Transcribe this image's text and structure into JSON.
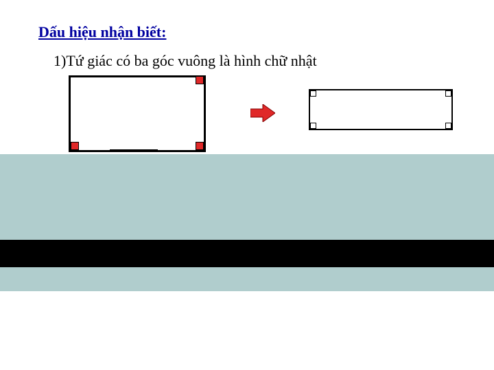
{
  "heading": "Dấu hiệu nhận biết:",
  "item1": "1)Tứ giác có ba góc vuông là hình chữ nhật",
  "colors": {
    "heading": "#0000a0",
    "marker_red": "#e02828",
    "arrow_red": "#e02828",
    "panel_bg": "#b0cdcd"
  },
  "icons": {
    "arrow": "right-arrow-icon"
  }
}
